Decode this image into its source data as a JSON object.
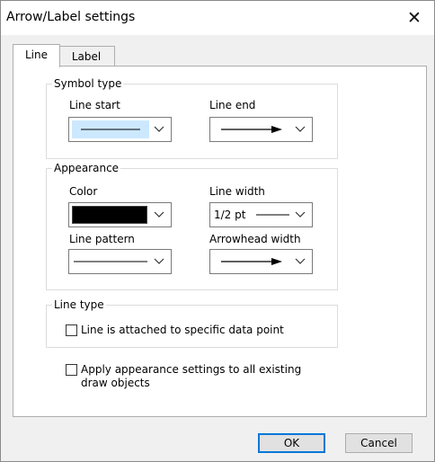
{
  "window": {
    "title": "Arrow/Label settings",
    "close_glyph": "✕"
  },
  "tabs": [
    {
      "label": "Line",
      "selected": true
    },
    {
      "label": "Label",
      "selected": false
    }
  ],
  "symbol_type": {
    "title": "Symbol type",
    "line_start": {
      "label": "Line start",
      "value_icon": "plain-line-icon"
    },
    "line_end": {
      "label": "Line end",
      "value_icon": "arrow-line-icon"
    }
  },
  "appearance": {
    "title": "Appearance",
    "color": {
      "label": "Color",
      "value": "#000000"
    },
    "line_width": {
      "label": "Line width",
      "value": "1/2 pt"
    },
    "line_pattern": {
      "label": "Line pattern",
      "value_icon": "solid-line-icon"
    },
    "arrowhead_width": {
      "label": "Arrowhead width",
      "value_icon": "arrow-line-icon"
    }
  },
  "line_type": {
    "title": "Line type",
    "attached_checkbox": {
      "label": "Line is attached to specific data point",
      "checked": false
    }
  },
  "apply_checkbox": {
    "label_line1": "Apply appearance settings to all existing",
    "label_line2": "draw objects",
    "checked": false
  },
  "buttons": {
    "ok": "OK",
    "cancel": "Cancel"
  },
  "colors": {
    "selection": "#cce8ff",
    "default_button_border": "#0078d7"
  }
}
